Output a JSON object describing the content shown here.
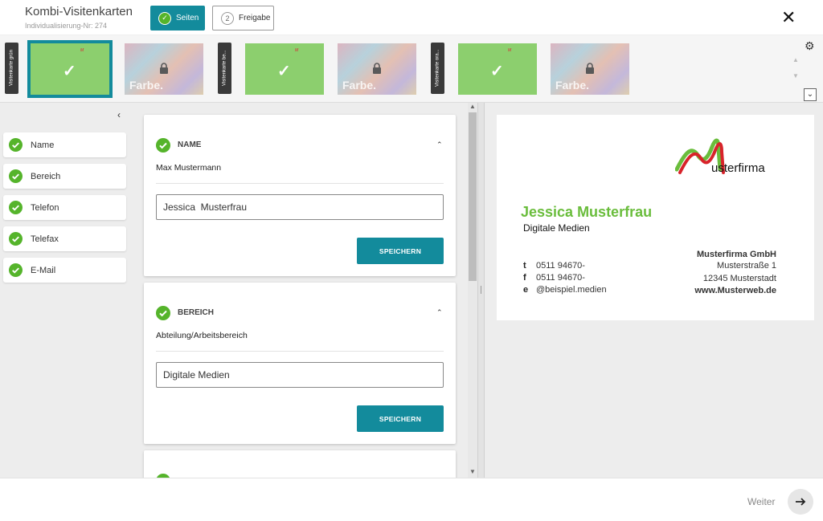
{
  "header": {
    "title": "Kombi-Visitenkarten",
    "subtitle": "Individualisierung-Nr: 274",
    "steps": [
      {
        "number": "✓",
        "label": "Seiten"
      },
      {
        "number": "2",
        "label": "Freigabe"
      }
    ],
    "close_glyph": "✕"
  },
  "strip": {
    "groups": [
      {
        "tab_label": "Visitenkarte grün"
      },
      {
        "tab_label": "Visitenkarte be..."
      },
      {
        "tab_label": "Visitenkarte ora..."
      }
    ],
    "locked_label": "Farbe.",
    "check_glyph": "✓"
  },
  "sidebar": {
    "collapse_glyph": "‹",
    "items": [
      {
        "label": "Name"
      },
      {
        "label": "Bereich"
      },
      {
        "label": "Telefon"
      },
      {
        "label": "Telefax"
      },
      {
        "label": "E-Mail"
      }
    ]
  },
  "form": {
    "sections": [
      {
        "title": "NAME",
        "field_label": "Max Mustermann",
        "value": "Jessica  Musterfrau",
        "save_label": "SPEICHERN"
      },
      {
        "title": "BEREICH",
        "field_label": "Abteilung/Arbeitsbereich",
        "value": "Digitale Medien",
        "save_label": "SPEICHERN"
      }
    ]
  },
  "preview": {
    "logo_text": "usterfirma",
    "name": "Jessica Musterfrau",
    "department": "Digitale Medien",
    "contacts": [
      {
        "prefix": "t",
        "value": "0511 94670-"
      },
      {
        "prefix": "f",
        "value": "0511 94670-"
      },
      {
        "prefix": "e",
        "value": "@beispiel.medien"
      }
    ],
    "company": {
      "name": "Musterfirma GmbH",
      "street": "Musterstraße 1",
      "city": "12345 Musterstadt",
      "web": "www.Musterweb.de"
    },
    "accent_color": "#6abd3c"
  },
  "footer": {
    "next_label": "Weiter"
  },
  "colors": {
    "primary": "#138b9c",
    "success": "#55b42b"
  }
}
